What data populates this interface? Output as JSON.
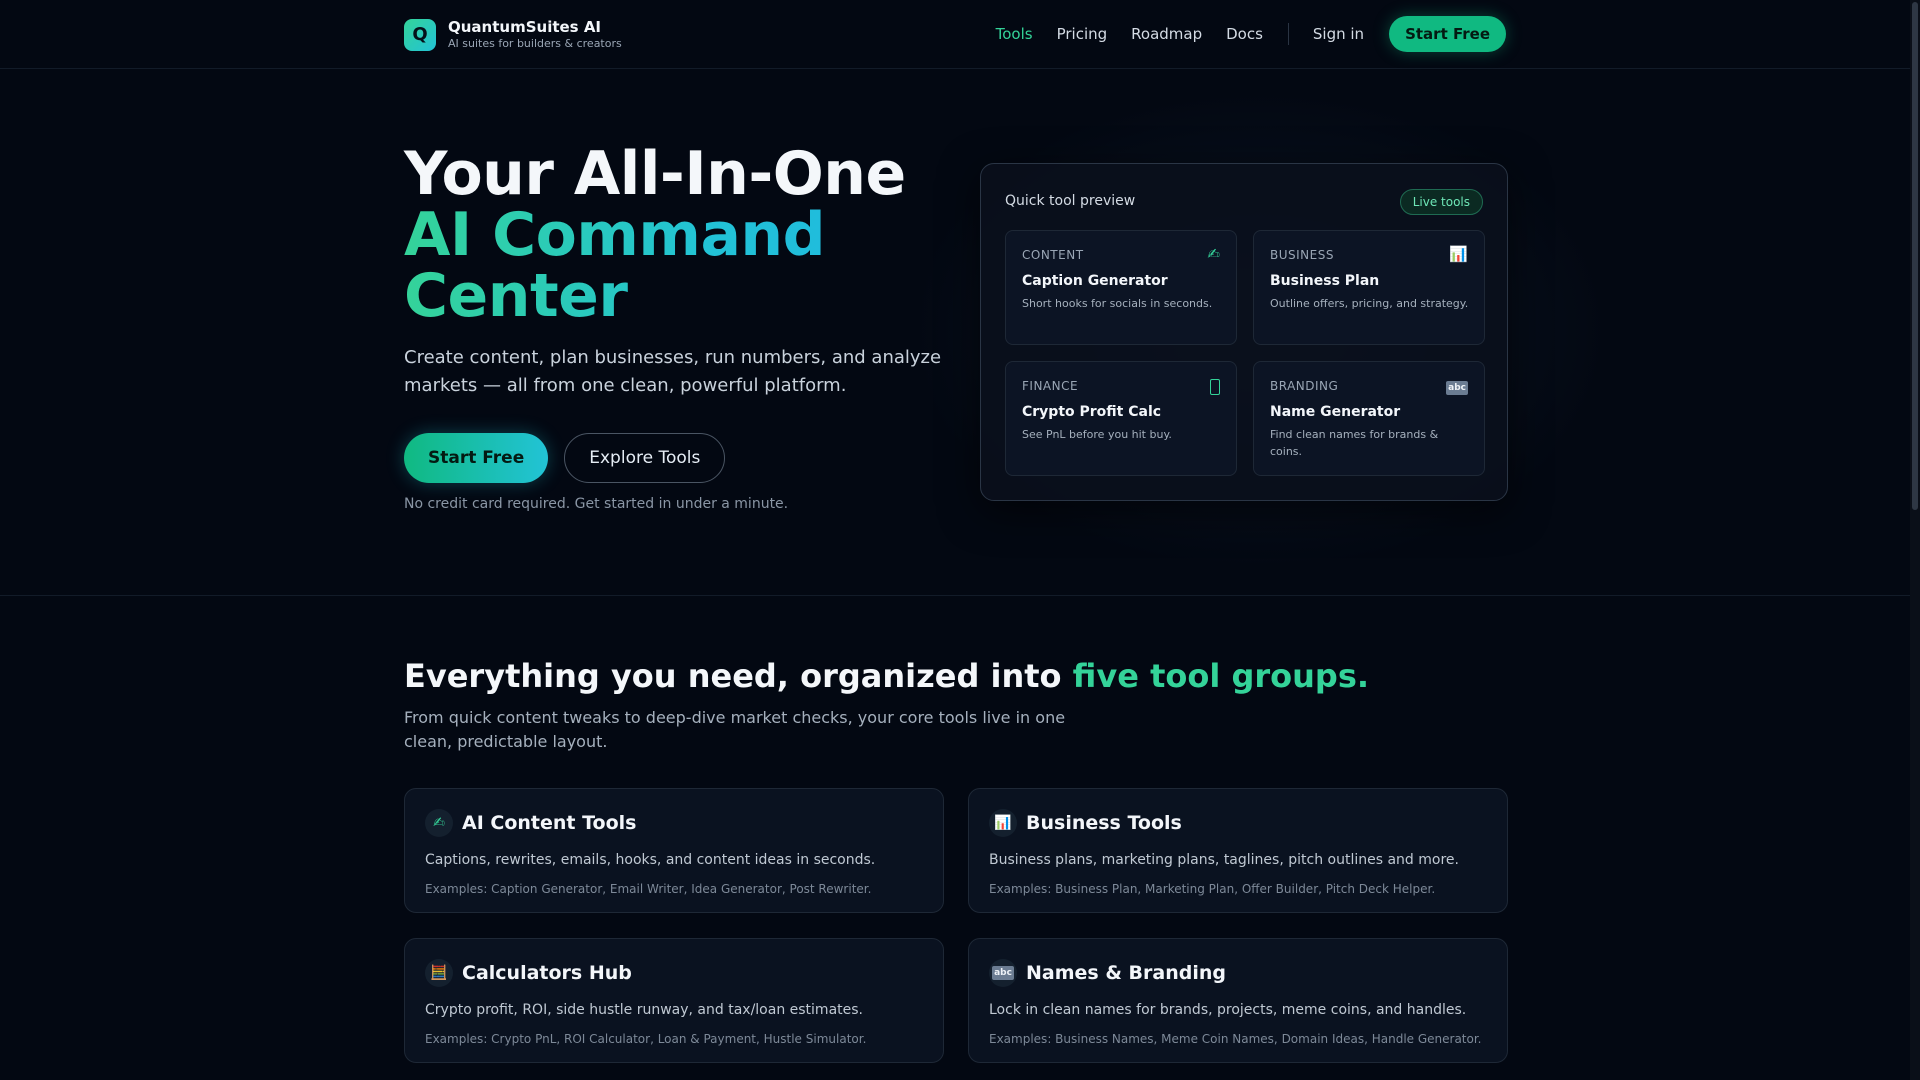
{
  "brand": {
    "logo_letter": "Q",
    "name": "QuantumSuites AI",
    "tagline": "AI suites for builders & creators"
  },
  "nav": {
    "links": [
      {
        "label": "Tools",
        "active": true
      },
      {
        "label": "Pricing",
        "active": false
      },
      {
        "label": "Roadmap",
        "active": false
      },
      {
        "label": "Docs",
        "active": false
      }
    ],
    "sign_in": "Sign in",
    "cta": "Start Free"
  },
  "hero": {
    "title_line1": "Your All-In-One",
    "title_line2": "AI Command",
    "title_line3": "Center",
    "subtitle": "Create content, plan businesses, run numbers, and analyze markets — all from one clean, powerful platform.",
    "primary_button": "Start Free",
    "secondary_button": "Explore Tools",
    "note": "No credit card required. Get started in under a minute."
  },
  "preview": {
    "title": "Quick tool preview",
    "badge": "Live tools",
    "tools": [
      {
        "category": "CONTENT",
        "name": "Caption Generator",
        "desc": "Short hooks for socials in seconds.",
        "icon": "pen-icon"
      },
      {
        "category": "BUSINESS",
        "name": "Business Plan",
        "desc": "Outline offers, pricing, and strategy.",
        "icon": "chart-icon"
      },
      {
        "category": "FINANCE",
        "name": "Crypto Profit Calc",
        "desc": "See PnL before you hit buy.",
        "icon": "coin-icon"
      },
      {
        "category": "BRANDING",
        "name": "Name Generator",
        "desc": "Find clean names for brands & coins.",
        "icon": "abc-icon"
      }
    ]
  },
  "section": {
    "title_prefix": "Everything you need, organized into",
    "title_accent": "five tool groups.",
    "subtitle": "From quick content tweaks to deep-dive market checks, your core tools live in one clean, predictable layout."
  },
  "groups": [
    {
      "title": "AI Content Tools",
      "desc": "Captions, rewrites, emails, hooks, and content ideas in seconds.",
      "examples": "Examples: Caption Generator, Email Writer, Idea Generator, Post Rewriter.",
      "icon": "pen-icon"
    },
    {
      "title": "Business Tools",
      "desc": "Business plans, marketing plans, taglines, pitch outlines and more.",
      "examples": "Examples: Business Plan, Marketing Plan, Offer Builder, Pitch Deck Helper.",
      "icon": "chart-icon"
    },
    {
      "title": "Calculators Hub",
      "desc": "Crypto profit, ROI, side hustle runway, and tax/loan estimates.",
      "examples": "Examples: Crypto PnL, ROI Calculator, Loan & Payment, Hustle Simulator.",
      "icon": "abacus-icon"
    },
    {
      "title": "Names & Branding",
      "desc": "Lock in clean names for brands, projects, meme coins, and handles.",
      "examples": "Examples: Business Names, Meme Coin Names, Domain Ideas, Handle Generator.",
      "icon": "abc-icon"
    }
  ],
  "colors": {
    "accent": "#34d399",
    "accent_alt": "#22c3d6",
    "background": "#030812"
  }
}
